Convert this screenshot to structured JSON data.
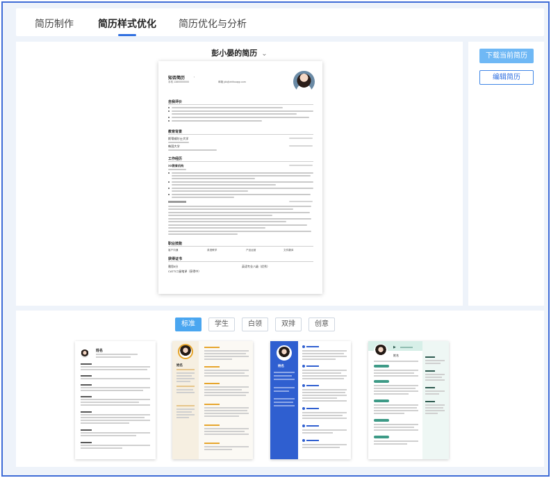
{
  "tabs": [
    {
      "label": "简历制作",
      "active": false
    },
    {
      "label": "简历样式优化",
      "active": true
    },
    {
      "label": "简历优化与分析",
      "active": false
    }
  ],
  "editor": {
    "resume_title": "彭小晏的简历",
    "chevron_icon": "chevron-down-icon"
  },
  "resume": {
    "name": "知否简历",
    "phone_label": "手机",
    "phone": "13800000000",
    "email_label": "邮箱",
    "email": "jdk@zhifouapp.com",
    "sections": {
      "evaluation": "自我评价",
      "education": "教育背景",
      "work": "工作经历",
      "skills": "职业技能",
      "certs": "获得证书"
    },
    "edu1": "斯蒂威尔士大学",
    "edu2": "韩国大学",
    "company": "XX教育机构",
    "cert1": "雅思8分",
    "cert2": "CATTI二级笔译（获得中）",
    "cert3": "英语专业八级（优秀）",
    "skill_tags": [
      "客户沟通",
      "英语教学",
      "产品运营",
      "文件翻译"
    ]
  },
  "side": {
    "download_label": "下载当前简历",
    "edit_label": "编辑简历"
  },
  "filters": [
    {
      "label": "标准",
      "active": true
    },
    {
      "label": "学生",
      "active": false
    },
    {
      "label": "白领",
      "active": false
    },
    {
      "label": "双排",
      "active": false
    },
    {
      "label": "创意",
      "active": false
    }
  ],
  "templates": [
    {
      "style": "standard",
      "name": "姓名"
    },
    {
      "style": "gold-sidebar",
      "name": "姓名"
    },
    {
      "style": "blue-sidebar",
      "name": "姓名"
    },
    {
      "style": "teal-header",
      "name": "姓名"
    }
  ],
  "colors": {
    "accent": "#2f6fe0",
    "download_button": "#6fb8f5",
    "gold": "#e6a52c",
    "blue_sidebar": "#2f5fd0",
    "teal": "#d7efe8"
  }
}
